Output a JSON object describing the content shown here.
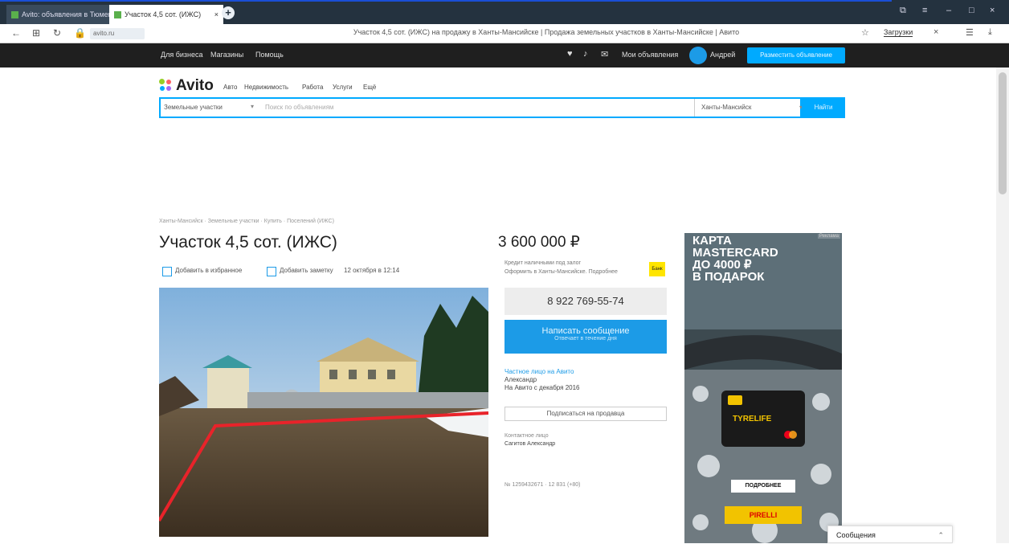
{
  "browser": {
    "tabs": [
      {
        "label": "Avito: объявления в Тюмени"
      },
      {
        "label": "Участок 4,5 сот. (ИЖС)"
      }
    ],
    "new_tab_symbol": "+",
    "url": "avito.ru",
    "page_title": "Участок 4,5 сот. (ИЖС) на продажу в Ханты-Мансийске | Продажа земельных участков в Ханты-Мансийске | Авито",
    "downloads_label": "Загрузки"
  },
  "topbar": {
    "links": [
      "Для бизнеса",
      "Магазины",
      "Помощь"
    ],
    "my_ads": "Мои объявления",
    "user": "Андрей",
    "post_ad": "Разместить объявление"
  },
  "header": {
    "logo": "Avito",
    "categories": [
      "Авто",
      "Недвижимость",
      "Работа",
      "Услуги",
      "Ещё"
    ]
  },
  "search": {
    "category": "Земельные участки",
    "placeholder": "Поиск по объявлениям",
    "city": "Ханты-Мансийск",
    "button": "Найти"
  },
  "listing": {
    "breadcrumbs": "Ханты-Мансийск · Земельные участки · Купить · Поселений (ИЖС)",
    "title": "Участок 4,5 сот. (ИЖС)",
    "actions": [
      "Добавить в избранное",
      "Добавить заметку"
    ],
    "date": "12 октября в 12:14",
    "price": "3 600 000 ₽",
    "credit_text": "Кредит наличными под залог",
    "credit_sub": "Оформить в Ханты-Мансийске. Подробнее",
    "badge": "Банк",
    "phone": "8 922 769-55-74",
    "write_message": "Написать сообщение",
    "write_message_sub": "Отвечает в течение дня",
    "seller_link": "Частное лицо на Авито",
    "seller_name": "Александр",
    "seller_since": "На Авито с декабря 2016",
    "subscribe": "Подписаться на продавца",
    "contact_label": "Контактное лицо",
    "contact_value": "Сагитов Александр",
    "ad_number": "№ 1259432671 · 12 831 (+80)"
  },
  "ad": {
    "text": [
      "КАРТА",
      "MASTERCARD",
      "ДО 4000 ₽",
      "В ПОДАРОК"
    ],
    "label": "Реклама",
    "card_text": "TYRELIFE",
    "button": "ПОДРОБНЕЕ",
    "brand": "PIRELLI"
  },
  "messages_widget": {
    "label": "Сообщения"
  },
  "colors": {
    "accent": "#00aaff",
    "button_blue": "#1c9be7",
    "topbar": "#1f1f1f",
    "badge": "#ffe500"
  }
}
